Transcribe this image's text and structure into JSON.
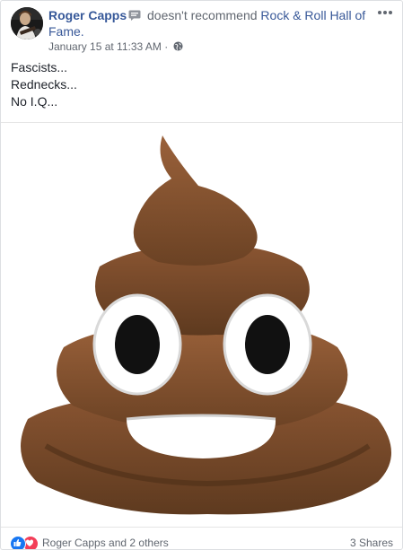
{
  "post": {
    "author": "Roger Capps",
    "verb": "doesn't recommend",
    "page": "Rock & Roll Hall of Fame.",
    "timestamp": "January 15 at 11:33 AM",
    "separator": "·",
    "lines": [
      "Fascists...",
      "Rednecks...",
      "No I.Q..."
    ]
  },
  "icons": {
    "badge": "recommendation-badge-icon",
    "privacy": "globe-icon",
    "more": "more-options-icon",
    "like": "like-icon",
    "love": "love-icon",
    "media": "pile-of-poo-emoji"
  },
  "footer": {
    "reactors": "Roger Capps and 2 others",
    "shares": "3 Shares"
  },
  "colors": {
    "name_link": "#365899",
    "secondary_text": "#616770",
    "like_blue": "#1877f2",
    "love_red": "#f33e58",
    "emoji_brown": "#7a4b2a"
  }
}
